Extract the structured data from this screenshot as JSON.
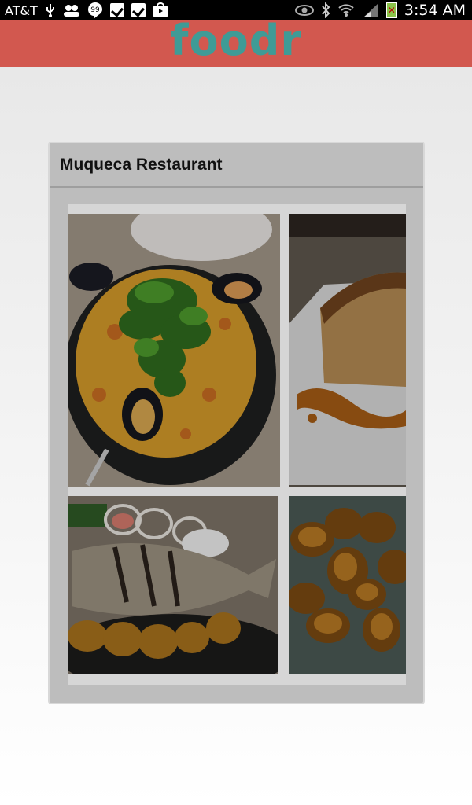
{
  "status_bar": {
    "carrier": "AT&T",
    "time": "3:54 AM"
  },
  "app": {
    "logo_text": "foodr",
    "header_color": "#d2584f",
    "logo_color": "#3f9b96"
  },
  "card": {
    "title": "Muqueca Restaurant",
    "photos": [
      {
        "name": "paella-with-mussels"
      },
      {
        "name": "cake-with-caramel"
      },
      {
        "name": "grilled-fish-with-plantains"
      },
      {
        "name": "fried-plantains"
      }
    ]
  }
}
